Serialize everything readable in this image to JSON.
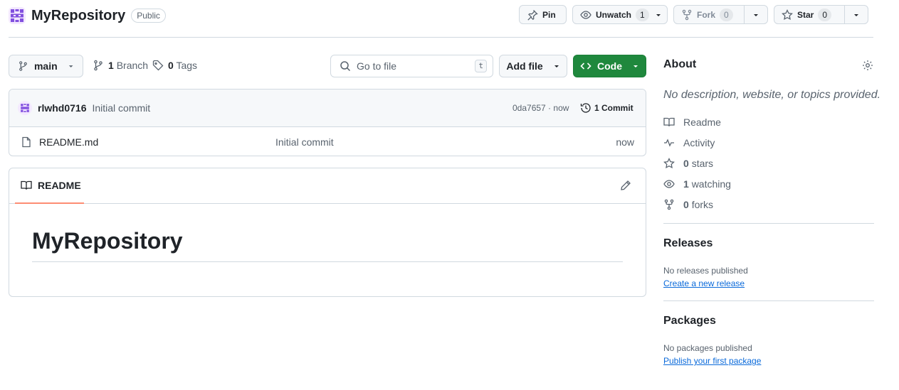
{
  "repo": {
    "name": "MyRepository",
    "visibility": "Public",
    "avatar_color": "#8250df"
  },
  "header_actions": {
    "pin_label": "Pin",
    "unwatch_label": "Unwatch",
    "watch_count": "1",
    "fork_label": "Fork",
    "fork_count": "0",
    "star_label": "Star",
    "star_count": "0"
  },
  "toolbar": {
    "branch_name": "main",
    "branch_count": "1",
    "branch_word": "Branch",
    "tag_count": "0",
    "tag_word": "Tags",
    "goto_placeholder": "Go to file",
    "goto_shortcut": "t",
    "add_file_label": "Add file",
    "code_label": "Code",
    "code_color": "#1f883d"
  },
  "latest_commit": {
    "author": "rlwhd0716",
    "message": "Initial commit",
    "sha": "0da7657",
    "sep": " · ",
    "time": "now",
    "commit_count_label": "1 Commit"
  },
  "files": [
    {
      "icon": "file-icon",
      "name": "README.md",
      "message": "Initial commit",
      "date": "now"
    }
  ],
  "readme": {
    "tab_label": "README",
    "heading": "MyRepository",
    "accent_color": "#fd8c73"
  },
  "about": {
    "title": "About",
    "description": "No description, website, or topics provided.",
    "readme_label": "Readme",
    "activity_label": "Activity",
    "stars_count": "0",
    "stars_word": "stars",
    "watching_count": "1",
    "watching_word": "watching",
    "forks_count": "0",
    "forks_word": "forks"
  },
  "releases": {
    "title": "Releases",
    "empty_text": "No releases published",
    "link_label": "Create a new release"
  },
  "packages": {
    "title": "Packages",
    "empty_text": "No packages published",
    "link_label": "Publish your first package"
  }
}
